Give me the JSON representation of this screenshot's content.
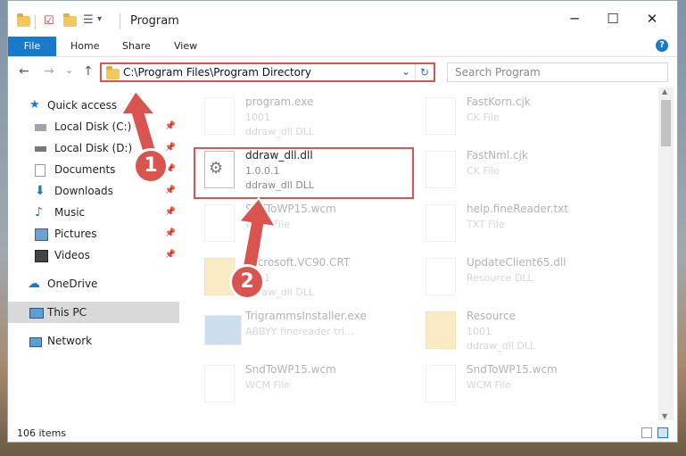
{
  "window": {
    "title": "Program",
    "minimize": "─",
    "maximize": "☐",
    "close": "✕"
  },
  "ribbon": {
    "file": "File",
    "home": "Home",
    "share": "Share",
    "view": "View",
    "help": "?"
  },
  "nav": {
    "back": "←",
    "forward": "→",
    "up": "↑",
    "address": "C:\\Program Files\\Program Directory",
    "dropdown": "⌄",
    "refresh": "↻",
    "search_placeholder": "Search Program"
  },
  "sidebar": {
    "items": [
      {
        "label": "Quick access"
      },
      {
        "label": "Local Disk (C:)"
      },
      {
        "label": "Local Disk (D:)"
      },
      {
        "label": "Documents"
      },
      {
        "label": "Downloads"
      },
      {
        "label": "Music"
      },
      {
        "label": "Pictures"
      },
      {
        "label": "Videos"
      },
      {
        "label": "OneDrive"
      },
      {
        "label": "This PC"
      },
      {
        "label": "Network"
      }
    ]
  },
  "files": [
    {
      "name": "program.exe",
      "line2": "1001",
      "line3": "ddraw_dll DLL"
    },
    {
      "name": "FastKorn.cjk",
      "line2": "CK File",
      "line3": ""
    },
    {
      "name": "ddraw_dll.dll",
      "line2": "1.0.0.1",
      "line3": "ddraw_dll DLL"
    },
    {
      "name": "FastNml.cjk",
      "line2": "CK File",
      "line3": ""
    },
    {
      "name": "SndToWP15.wcm",
      "line2": "WCM File",
      "line3": ""
    },
    {
      "name": "help.fineReader.txt",
      "line2": "TXT File",
      "line3": ""
    },
    {
      "name": "Microsoft.VC90.CRT",
      "line2": "1001",
      "line3": "ddraw_dll DLL"
    },
    {
      "name": "UpdateClient65.dll",
      "line2": "Resource DLL",
      "line3": ""
    },
    {
      "name": "TrigrammsInstaller.exe",
      "line2": "ABBYY finereader tri...",
      "line3": ""
    },
    {
      "name": "Resource",
      "line2": "1001",
      "line3": "ddraw_dll DLL"
    },
    {
      "name": "SndToWP15.wcm",
      "line2": "WCM File",
      "line3": ""
    },
    {
      "name": "SndToWP15.wcm",
      "line2": "WCM File",
      "line3": ""
    }
  ],
  "status": {
    "count": "106 items"
  },
  "annotations": {
    "step1": "1",
    "step2": "2"
  },
  "colors": {
    "accent": "#1979ca",
    "highlight": "#d9534f"
  }
}
